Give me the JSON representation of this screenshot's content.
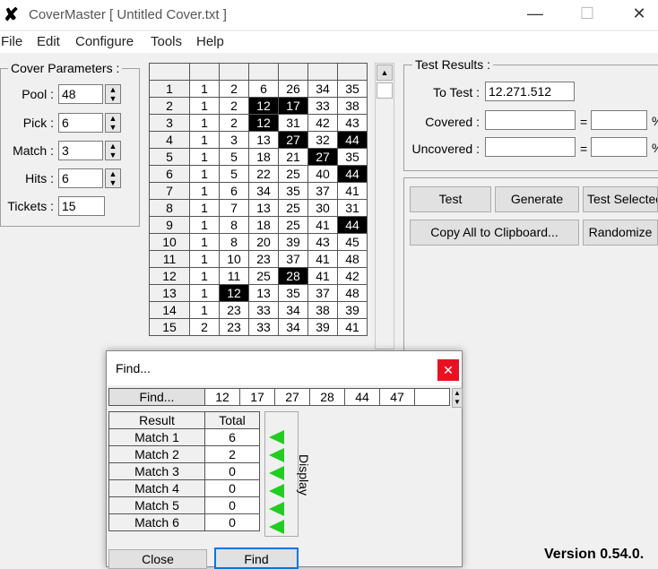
{
  "window": {
    "icon_glyph": "✘",
    "title": "CoverMaster [ Untitled Cover.txt ]",
    "minimize": "—",
    "maximize": "☐",
    "close": "✕"
  },
  "menu": [
    "File",
    "Edit",
    "Configure",
    "Tools",
    "Help"
  ],
  "cover_params": {
    "title": "Cover Parameters :",
    "pool_label": "Pool :",
    "pool": "48",
    "pick_label": "Pick :",
    "pick": "6",
    "match_label": "Match :",
    "match": "3",
    "hits_label": "Hits :",
    "hits": "6",
    "tickets_label": "Tickets :",
    "tickets": "15"
  },
  "grid": {
    "rows": [
      {
        "n": "1",
        "v": [
          "1",
          "2",
          "6",
          "26",
          "34",
          "35"
        ],
        "hl": []
      },
      {
        "n": "2",
        "v": [
          "1",
          "2",
          "12",
          "17",
          "33",
          "38"
        ],
        "hl": [
          2,
          3
        ]
      },
      {
        "n": "3",
        "v": [
          "1",
          "2",
          "12",
          "31",
          "42",
          "43"
        ],
        "hl": [
          2
        ]
      },
      {
        "n": "4",
        "v": [
          "1",
          "3",
          "13",
          "27",
          "32",
          "44"
        ],
        "hl": [
          3,
          5
        ]
      },
      {
        "n": "5",
        "v": [
          "1",
          "5",
          "18",
          "21",
          "27",
          "35"
        ],
        "hl": [
          4
        ]
      },
      {
        "n": "6",
        "v": [
          "1",
          "5",
          "22",
          "25",
          "40",
          "44"
        ],
        "hl": [
          5
        ]
      },
      {
        "n": "7",
        "v": [
          "1",
          "6",
          "34",
          "35",
          "37",
          "41"
        ],
        "hl": []
      },
      {
        "n": "8",
        "v": [
          "1",
          "7",
          "13",
          "25",
          "30",
          "31"
        ],
        "hl": []
      },
      {
        "n": "9",
        "v": [
          "1",
          "8",
          "18",
          "25",
          "41",
          "44"
        ],
        "hl": [
          5
        ]
      },
      {
        "n": "10",
        "v": [
          "1",
          "8",
          "20",
          "39",
          "43",
          "45"
        ],
        "hl": []
      },
      {
        "n": "11",
        "v": [
          "1",
          "10",
          "23",
          "37",
          "41",
          "48"
        ],
        "hl": []
      },
      {
        "n": "12",
        "v": [
          "1",
          "11",
          "25",
          "28",
          "41",
          "42"
        ],
        "hl": [
          3
        ]
      },
      {
        "n": "13",
        "v": [
          "1",
          "12",
          "13",
          "35",
          "37",
          "48"
        ],
        "hl": [
          1
        ]
      },
      {
        "n": "14",
        "v": [
          "1",
          "23",
          "33",
          "34",
          "38",
          "39"
        ],
        "hl": []
      },
      {
        "n": "15",
        "v": [
          "2",
          "23",
          "33",
          "34",
          "39",
          "41"
        ],
        "hl": []
      }
    ]
  },
  "test_results": {
    "title": "Test Results :",
    "to_test_label": "To Test :",
    "to_test": "12.271.512",
    "covered_label": "Covered :",
    "covered": "",
    "covered_eq": "=",
    "covered_pct": "",
    "uncovered_label": "Uncovered :",
    "uncovered": "",
    "uncovered_eq": "=",
    "uncovered_pct": "",
    "pct_sign": "%"
  },
  "buttons": {
    "test": "Test",
    "generate": "Generate",
    "test_selected": "Test Selected",
    "copy_all": "Copy All to Clipboard...",
    "randomize": "Randomize"
  },
  "find_dialog": {
    "title": "Find...",
    "close_x": "✕",
    "find_btn": "Find...",
    "numbers": [
      "12",
      "17",
      "27",
      "28",
      "44",
      "47",
      ""
    ],
    "result_header": "Result",
    "total_header": "Total",
    "results": [
      {
        "label": "Match 1",
        "total": "6"
      },
      {
        "label": "Match 2",
        "total": "2"
      },
      {
        "label": "Match 3",
        "total": "0"
      },
      {
        "label": "Match 4",
        "total": "0"
      },
      {
        "label": "Match 5",
        "total": "0"
      },
      {
        "label": "Match 6",
        "total": "0"
      }
    ],
    "display_label": "Display",
    "close_btn": "Close",
    "find_action": "Find"
  },
  "version": "Version 0.54.0."
}
